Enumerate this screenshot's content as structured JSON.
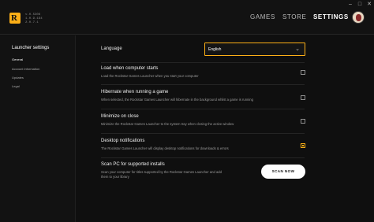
{
  "app": {
    "version_lines": [
      "v.0.5306",
      "1.0.9.194",
      "2.0.7.1"
    ]
  },
  "nav": {
    "games": "GAMES",
    "store": "STORE",
    "settings": "SETTINGS"
  },
  "sidebar": {
    "title": "Launcher settings",
    "items": [
      {
        "label": "General"
      },
      {
        "label": "Account information"
      },
      {
        "label": "Updates"
      },
      {
        "label": "Legal"
      }
    ]
  },
  "settings": {
    "language": {
      "label": "Language",
      "value": "English"
    },
    "load_on_start": {
      "label": "Load when computer starts",
      "desc": "Load the Rockstar Games Launcher when you start your computer",
      "checked": false
    },
    "hibernate": {
      "label": "Hibernate when running a game",
      "desc": "When selected, the Rockstar Games Launcher will hibernate in the background whilst a game is running",
      "checked": false
    },
    "minimize": {
      "label": "Minimize on close",
      "desc": "Minimize the Rockstar Games Launcher to the system tray when closing the active window",
      "checked": false
    },
    "notifications": {
      "label": "Desktop notifications",
      "desc": "The Rockstar Games Launcher will display desktop notifications for downloads & errors",
      "checked": true
    },
    "scan": {
      "label": "Scan PC for supported installs",
      "desc_line1": "Scan your computer for titles supported by the Rockstar Games Launcher and add",
      "desc_line2": "them to your library",
      "button": "SCAN NOW"
    }
  },
  "colors": {
    "accent": "#fcaf17",
    "background": "#0f0f0f"
  }
}
